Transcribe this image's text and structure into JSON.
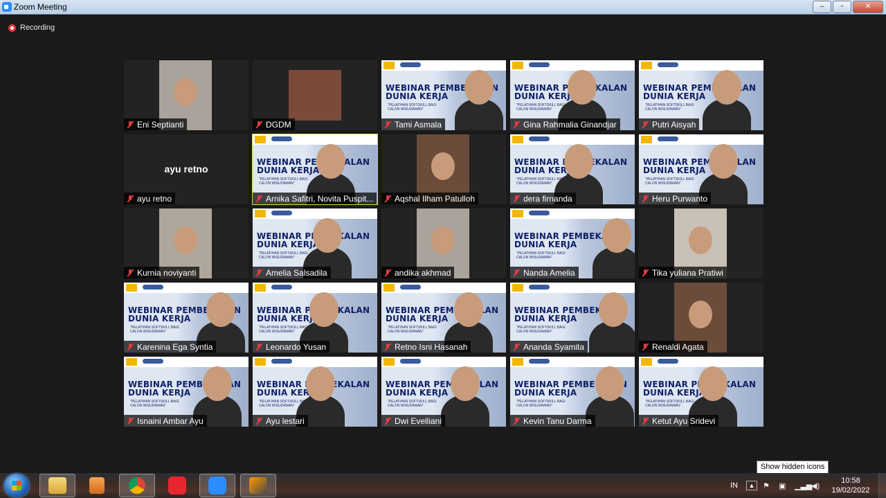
{
  "window": {
    "title": "Zoom Meeting",
    "minimize": "–",
    "maximize": "▫",
    "close": "✕"
  },
  "recording": {
    "label": "Recording"
  },
  "slide": {
    "line1": "WEBINAR PEMBEKALAN",
    "line2": "DUNIA KERJA",
    "sub1": "\"PELATIHAN SOFTSKILL BAGI",
    "sub2": "CALON WISUDAWAN\""
  },
  "participants": [
    {
      "name": "Eni Septianti",
      "muted": true,
      "bg": "cam"
    },
    {
      "name": "DGDM",
      "muted": true,
      "bg": "block"
    },
    {
      "name": "Tami Asmala",
      "muted": true,
      "bg": "slide"
    },
    {
      "name": "Gina Rahmalia Ginandjar",
      "muted": true,
      "bg": "slide"
    },
    {
      "name": "Putri Aisyah",
      "muted": true,
      "bg": "slide"
    },
    {
      "name": "ayu retno",
      "muted": true,
      "bg": "none",
      "center_label": "ayu retno"
    },
    {
      "name": "Arnika Safitri, Novita Puspit...",
      "muted": true,
      "bg": "slide",
      "speaking": true
    },
    {
      "name": "Aqshal Ilham Patulloh",
      "muted": true,
      "bg": "cam"
    },
    {
      "name": "dera firnanda",
      "muted": true,
      "bg": "slide"
    },
    {
      "name": "Heru Purwanto",
      "muted": true,
      "bg": "slide"
    },
    {
      "name": "Kurnia noviyanti",
      "muted": true,
      "bg": "cam"
    },
    {
      "name": "Amelia Salsadila",
      "muted": true,
      "bg": "slide"
    },
    {
      "name": "andika akhmad",
      "muted": true,
      "bg": "cam"
    },
    {
      "name": "Nanda Amelia",
      "muted": true,
      "bg": "slide"
    },
    {
      "name": "Tika yuliana Pratiwi",
      "muted": true,
      "bg": "cam"
    },
    {
      "name": "Karenina Ega Syntia",
      "muted": true,
      "bg": "slide"
    },
    {
      "name": "Leonardo Yusan",
      "muted": true,
      "bg": "slide"
    },
    {
      "name": "Retno Isni Hasanah",
      "muted": true,
      "bg": "slide"
    },
    {
      "name": "Ananda Syamita",
      "muted": true,
      "bg": "slide"
    },
    {
      "name": "Renaldi Agata",
      "muted": true,
      "bg": "cam"
    },
    {
      "name": "Isnaini Ambar Ayu",
      "muted": true,
      "bg": "slide"
    },
    {
      "name": "Ayu lestari",
      "muted": true,
      "bg": "slide"
    },
    {
      "name": "Dwi Evelliani",
      "muted": true,
      "bg": "slide"
    },
    {
      "name": "Kevin Tanu Darma",
      "muted": true,
      "bg": "slide"
    },
    {
      "name": "Ketut Ayu Sridevi",
      "muted": true,
      "bg": "slide"
    }
  ],
  "tooltip": {
    "text": "Show hidden icons"
  },
  "taskbar": {
    "apps": [
      "start-button",
      "file-explorer",
      "media-player",
      "chrome",
      "vivaldi",
      "zoom",
      "sublime"
    ],
    "language": "IN",
    "time": "10:58",
    "date": "19/02/2022"
  },
  "colors": {
    "background": "#1a1a1a",
    "speaking_outline": "#c9df3d",
    "muted_icon": "#e23d3d",
    "recording": "#e0373a"
  }
}
